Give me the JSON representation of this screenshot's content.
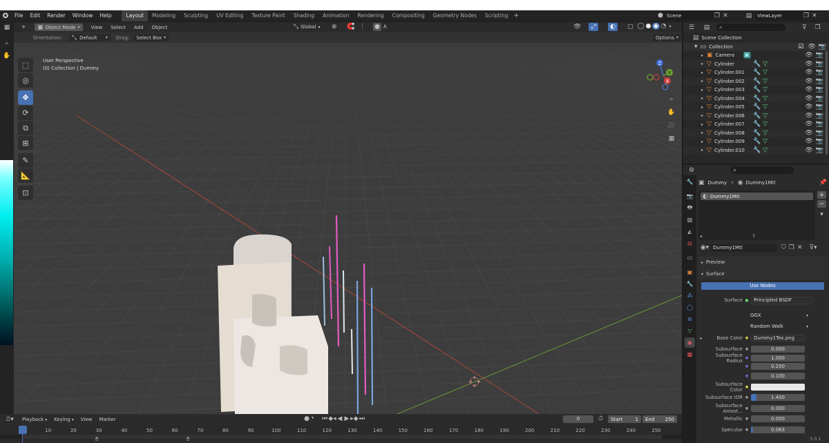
{
  "menu": {
    "file": "File",
    "edit": "Edit",
    "render": "Render",
    "window": "Window",
    "help": "Help"
  },
  "workspaces": [
    "Layout",
    "Modeling",
    "Sculpting",
    "UV Editing",
    "Texture Paint",
    "Shading",
    "Animation",
    "Rendering",
    "Compositing",
    "Geometry Nodes",
    "Scripting"
  ],
  "scene": {
    "name": "Scene",
    "view_layer": "ViewLayer"
  },
  "viewport": {
    "mode": "Object Mode",
    "menus": {
      "view": "View",
      "select": "Select",
      "add": "Add",
      "object": "Object"
    },
    "transform": "Global",
    "orientation_label": "Orientation:",
    "orientation_value": "Default",
    "drag_label": "Drag:",
    "drag_value": "Select Box",
    "options": "Options",
    "info_line1": "User Perspective",
    "info_line2": "(0) Collection | Dummy",
    "gizmo": {
      "z": "Z",
      "x": "X",
      "y": "Y"
    }
  },
  "outliner": {
    "root": "Scene Collection",
    "collection": "Collection",
    "items": [
      "Camera",
      "Cylinder",
      "Cylinder.001",
      "Cylinder.002",
      "Cylinder.003",
      "Cylinder.004",
      "Cylinder.005",
      "Cylinder.006",
      "Cylinder.007",
      "Cylinder.008",
      "Cylinder.009",
      "Cylinder.010"
    ]
  },
  "properties": {
    "breadcrumb_object": "Dummy",
    "breadcrumb_material": "Dummy1Mtl",
    "slot": "Dummy1Mtl",
    "material_name": "Dummy1Mtl",
    "preview": "Preview",
    "surface": "Surface",
    "use_nodes": "Use Nodes",
    "surface_label": "Surface",
    "surface_value": "Principled BSDF",
    "distribution": "GGX",
    "sss_method": "Random Walk",
    "rows": [
      {
        "label": "Base Color",
        "value": "Dummy1Tex.png"
      },
      {
        "label": "Subsurface",
        "value": "0.000"
      },
      {
        "label": "Subsurface Radius",
        "value": "1.000"
      },
      {
        "label": "",
        "value": "0.200"
      },
      {
        "label": "",
        "value": "0.100"
      },
      {
        "label": "Subsurface Color",
        "value": ""
      },
      {
        "label": "Subsurface IOR",
        "value": "1.400"
      },
      {
        "label": "Subsurface Anisot...",
        "value": "0.000"
      },
      {
        "label": "Metallic",
        "value": "0.000"
      },
      {
        "label": "Specular",
        "value": "0.063"
      }
    ]
  },
  "timeline": {
    "playback": "Playback",
    "keying": "Keying",
    "view": "View",
    "marker": "Marker",
    "current_frame": "0",
    "start_label": "Start",
    "start_value": "1",
    "end_label": "End",
    "end_value": "250",
    "ticks": [
      "0",
      "10",
      "20",
      "30",
      "40",
      "50",
      "60",
      "70",
      "80",
      "90",
      "100",
      "110",
      "120",
      "130",
      "140",
      "150",
      "160",
      "170",
      "180",
      "190",
      "200",
      "210",
      "220",
      "230",
      "240",
      "250"
    ]
  },
  "status": {
    "version": "3.0.1"
  },
  "colors": {
    "accent": "#4772b3",
    "x_axis": "#d0503c",
    "y_axis": "#7bb03a",
    "bg_viewport": "#3d3d3d"
  }
}
